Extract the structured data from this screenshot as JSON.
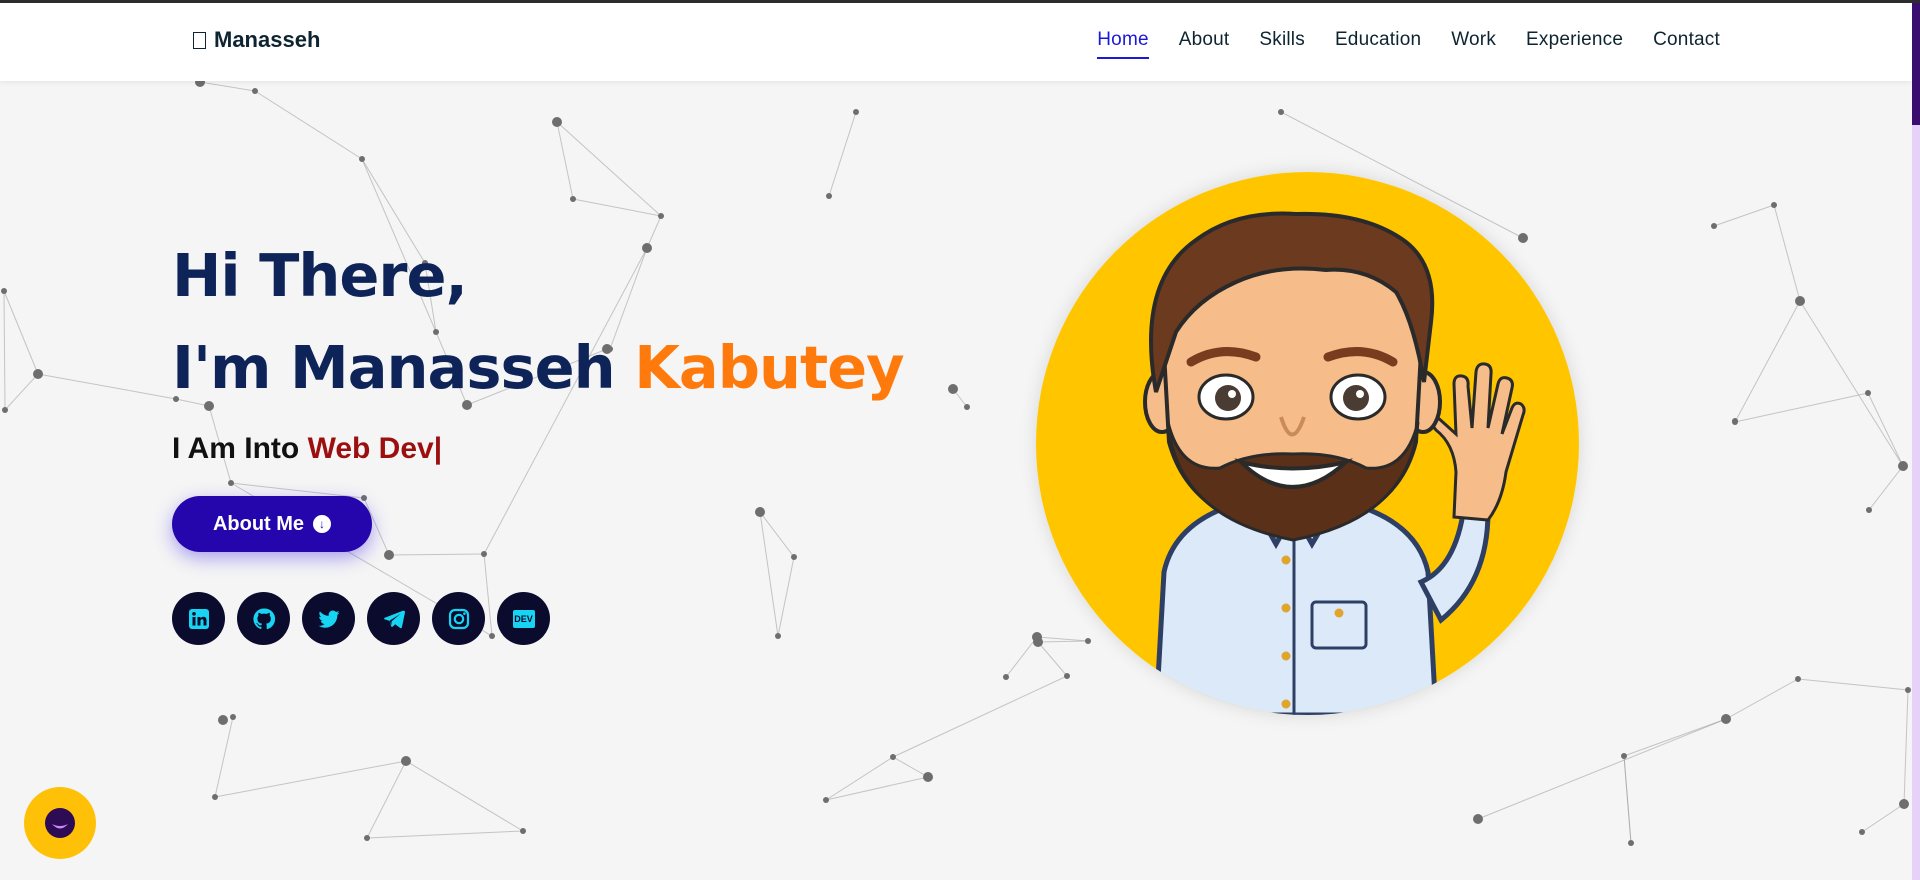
{
  "brand": {
    "icon": "code-icon",
    "name": "Manasseh"
  },
  "nav": {
    "items": [
      {
        "label": "Home",
        "active": true
      },
      {
        "label": "About",
        "active": false
      },
      {
        "label": "Skills",
        "active": false
      },
      {
        "label": "Education",
        "active": false
      },
      {
        "label": "Work",
        "active": false
      },
      {
        "label": "Experience",
        "active": false
      },
      {
        "label": "Contact",
        "active": false
      }
    ]
  },
  "hero": {
    "greeting": "Hi There,",
    "name_prefix": "I'm Manasseh",
    "name_accent": "Kabutey",
    "typing_prefix": "I Am Into",
    "typing_value": "Web Dev|",
    "button_label": "About Me",
    "button_icon": "arrow-down-circle-icon",
    "socials": [
      "linkedin-icon",
      "github-icon",
      "twitter-icon",
      "telegram-icon",
      "instagram-icon",
      "dev-icon"
    ]
  },
  "avatar": {
    "icon": "waving-cartoon-avatar"
  },
  "chat": {
    "icon": "chat-bubble-icon"
  },
  "colors": {
    "primary_navy": "#0e2459",
    "accent_orange": "#ff7a0d",
    "accent_red": "#9b0f0f",
    "button_blue": "#2506ad",
    "nav_active": "#1c18d8",
    "avatar_bg": "#ffc600",
    "chat_bg": "#ffc107",
    "social_bg": "#0b0b2e",
    "social_icon": "#16d4f2"
  }
}
